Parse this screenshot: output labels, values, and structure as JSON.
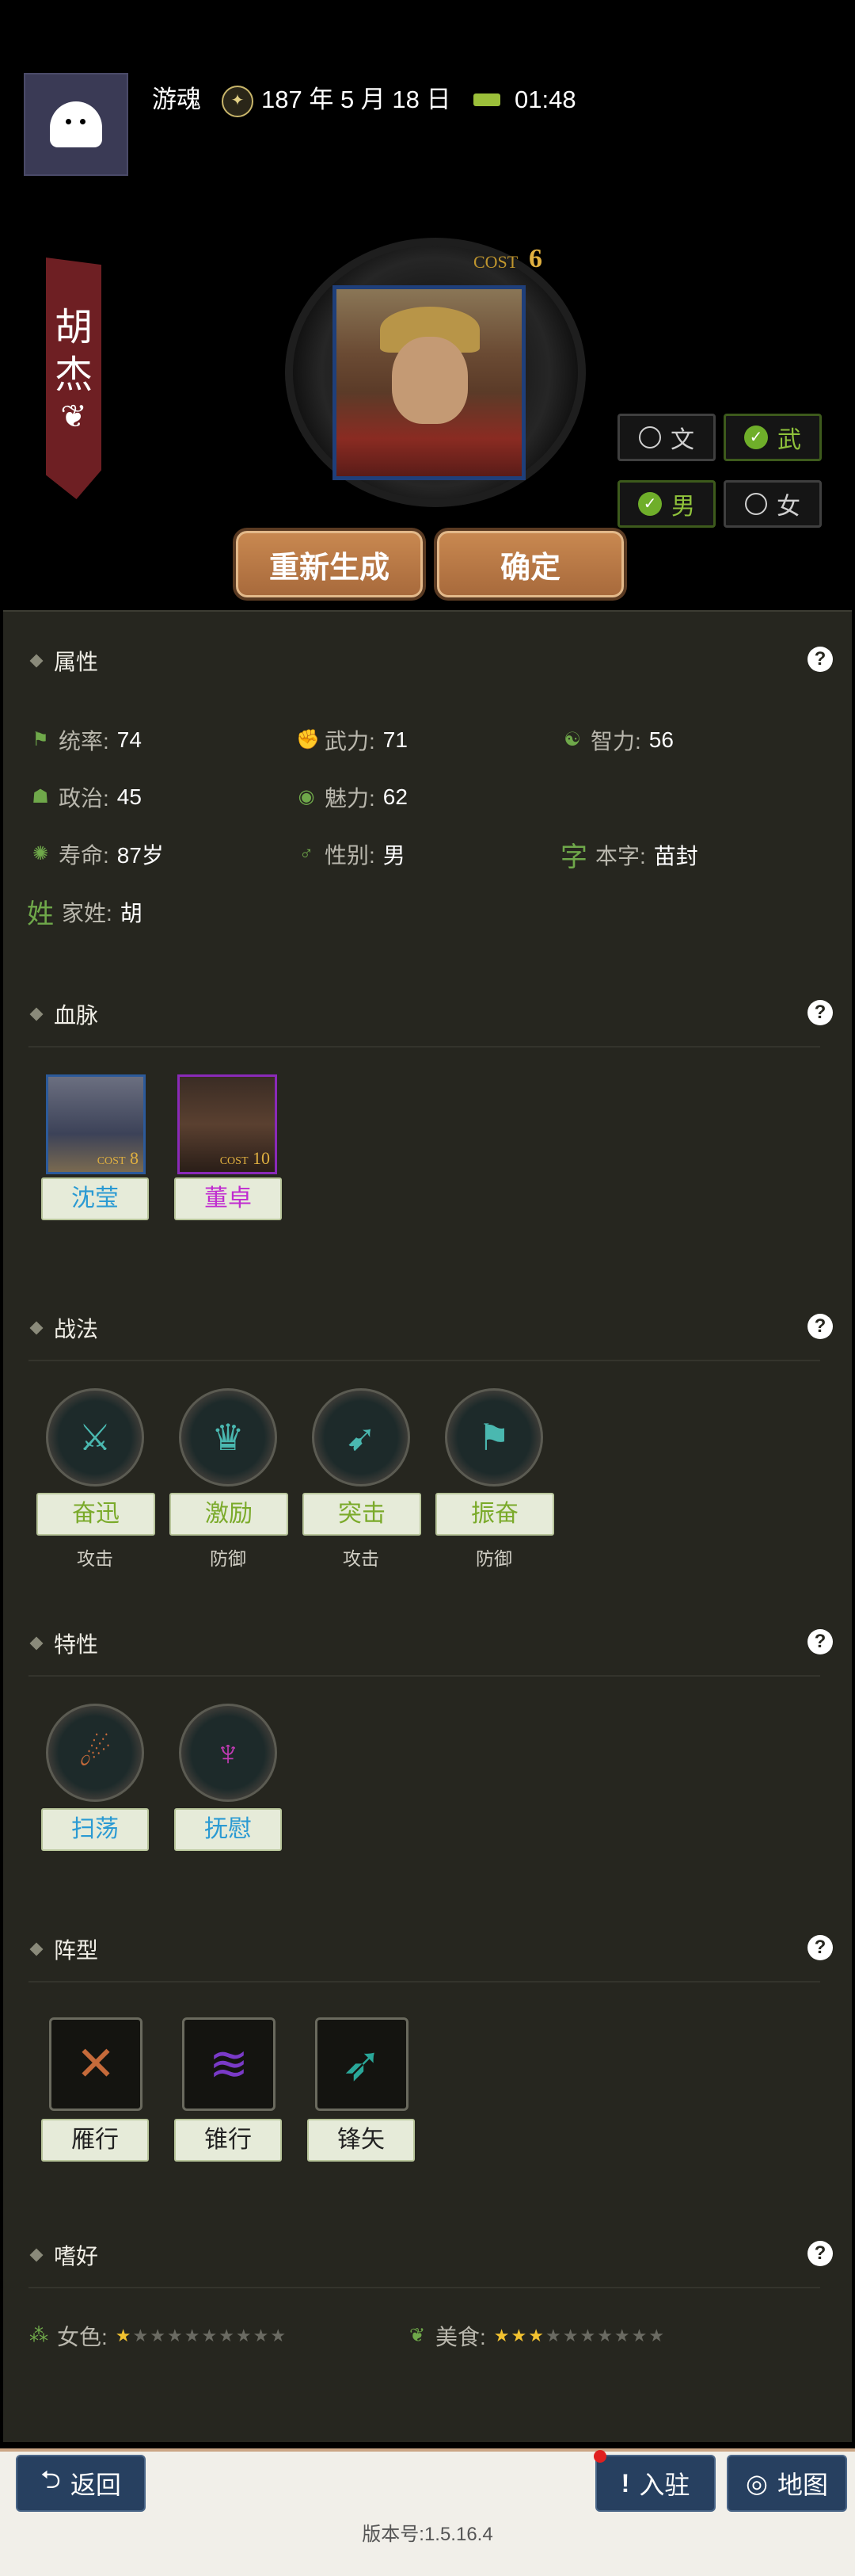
{
  "header": {
    "username": "游魂",
    "date": "187 年 5 月 18 日",
    "time": "01:48"
  },
  "character": {
    "name_chars": [
      "胡",
      "杰"
    ],
    "cost_label": "COST",
    "cost": "6"
  },
  "options": {
    "wen": "文",
    "wu": "武",
    "male": "男",
    "female": "女",
    "selected": [
      "武",
      "男"
    ]
  },
  "buttons": {
    "regenerate": "重新生成",
    "confirm": "确定"
  },
  "sections": {
    "attributes": {
      "title": "属性",
      "items": [
        {
          "label": "统率:",
          "value": "74"
        },
        {
          "label": "武力:",
          "value": "71"
        },
        {
          "label": "智力:",
          "value": "56"
        },
        {
          "label": "政治:",
          "value": "45"
        },
        {
          "label": "魅力:",
          "value": "62"
        },
        {
          "label": "寿命:",
          "value": "87岁"
        },
        {
          "label": "性别:",
          "value": "男"
        },
        {
          "label": "本字:",
          "value": "苗封",
          "icon_char": "字"
        },
        {
          "label": "家姓:",
          "value": "胡",
          "icon_char": "姓"
        }
      ]
    },
    "bloodline": {
      "title": "血脉",
      "items": [
        {
          "name": "沈莹",
          "cost_label": "COST",
          "cost": "8"
        },
        {
          "name": "董卓",
          "cost_label": "COST",
          "cost": "10"
        }
      ]
    },
    "tactics": {
      "title": "战法",
      "items": [
        {
          "name": "奋迅",
          "type": "攻击"
        },
        {
          "name": "激励",
          "type": "防御"
        },
        {
          "name": "突击",
          "type": "攻击"
        },
        {
          "name": "振奋",
          "type": "防御"
        }
      ]
    },
    "traits": {
      "title": "特性",
      "items": [
        {
          "name": "扫荡"
        },
        {
          "name": "抚慰"
        }
      ]
    },
    "formation": {
      "title": "阵型",
      "items": [
        {
          "name": "雁行"
        },
        {
          "name": "锥行"
        },
        {
          "name": "锋矢"
        }
      ]
    },
    "hobbies": {
      "title": "嗜好",
      "items": [
        {
          "label": "女色:",
          "rating": 1,
          "max": 10
        },
        {
          "label": "美食:",
          "rating": 2.5,
          "max": 10
        }
      ]
    }
  },
  "bottom": {
    "back": "返回",
    "station": "入驻",
    "map": "地图",
    "version": "版本号:1.5.16.4"
  },
  "colors": {
    "panel": "#26261f",
    "accent_green": "#6fa84a",
    "button_brown": "#b57a46",
    "blue_btn": "#274060"
  }
}
